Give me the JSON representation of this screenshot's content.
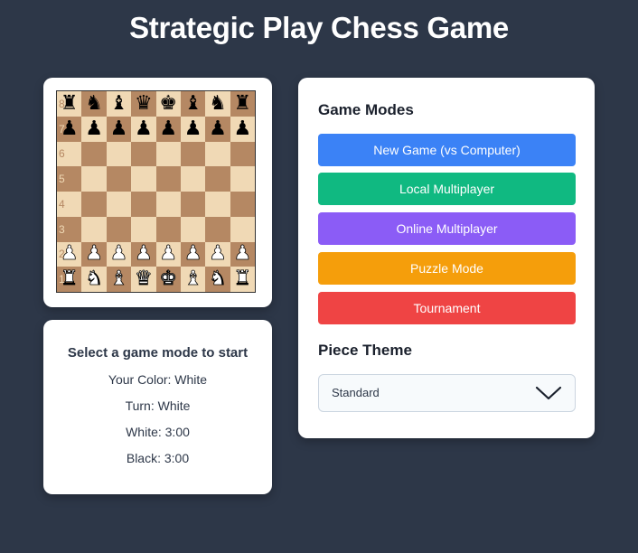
{
  "page": {
    "title": "Strategic Play Chess Game"
  },
  "board": {
    "rows": [
      {
        "rank": "8",
        "pieces": [
          {
            "g": "♜",
            "c": "black"
          },
          {
            "g": "♞",
            "c": "black"
          },
          {
            "g": "♝",
            "c": "black"
          },
          {
            "g": "♛",
            "c": "black"
          },
          {
            "g": "♚",
            "c": "black"
          },
          {
            "g": "♝",
            "c": "black"
          },
          {
            "g": "♞",
            "c": "black"
          },
          {
            "g": "♜",
            "c": "black"
          }
        ]
      },
      {
        "rank": "7",
        "pieces": [
          {
            "g": "♟",
            "c": "black"
          },
          {
            "g": "♟",
            "c": "black"
          },
          {
            "g": "♟",
            "c": "black"
          },
          {
            "g": "♟",
            "c": "black"
          },
          {
            "g": "♟",
            "c": "black"
          },
          {
            "g": "♟",
            "c": "black"
          },
          {
            "g": "♟",
            "c": "black"
          },
          {
            "g": "♟",
            "c": "black"
          }
        ]
      },
      {
        "rank": "6",
        "pieces": []
      },
      {
        "rank": "5",
        "pieces": []
      },
      {
        "rank": "4",
        "pieces": []
      },
      {
        "rank": "3",
        "pieces": []
      },
      {
        "rank": "2",
        "pieces": [
          {
            "g": "♟",
            "c": "white"
          },
          {
            "g": "♟",
            "c": "white"
          },
          {
            "g": "♟",
            "c": "white"
          },
          {
            "g": "♟",
            "c": "white"
          },
          {
            "g": "♟",
            "c": "white"
          },
          {
            "g": "♟",
            "c": "white"
          },
          {
            "g": "♟",
            "c": "white"
          },
          {
            "g": "♟",
            "c": "white"
          }
        ]
      },
      {
        "rank": "1",
        "pieces": [
          {
            "g": "♜",
            "c": "white"
          },
          {
            "g": "♞",
            "c": "white"
          },
          {
            "g": "♝",
            "c": "white"
          },
          {
            "g": "♛",
            "c": "white"
          },
          {
            "g": "♚",
            "c": "white"
          },
          {
            "g": "♝",
            "c": "white"
          },
          {
            "g": "♞",
            "c": "white"
          },
          {
            "g": "♜",
            "c": "white"
          }
        ]
      }
    ],
    "colors": {
      "light": "#f0d9b5",
      "dark": "#b58863"
    }
  },
  "status": {
    "heading": "Select a game mode to start",
    "your_color": "Your Color: White",
    "turn": "Turn: White",
    "white_time": "White: 3:00",
    "black_time": "Black: 3:00"
  },
  "modes": {
    "title": "Game Modes",
    "buttons": [
      {
        "label": "New Game (vs Computer)",
        "color": "#3b82f6"
      },
      {
        "label": "Local Multiplayer",
        "color": "#10b981"
      },
      {
        "label": "Online Multiplayer",
        "color": "#8b5cf6"
      },
      {
        "label": "Puzzle Mode",
        "color": "#f59e0b"
      },
      {
        "label": "Tournament",
        "color": "#ef4444"
      }
    ]
  },
  "theme": {
    "title": "Piece Theme",
    "selected": "Standard",
    "icon": "chevron-down-icon"
  }
}
